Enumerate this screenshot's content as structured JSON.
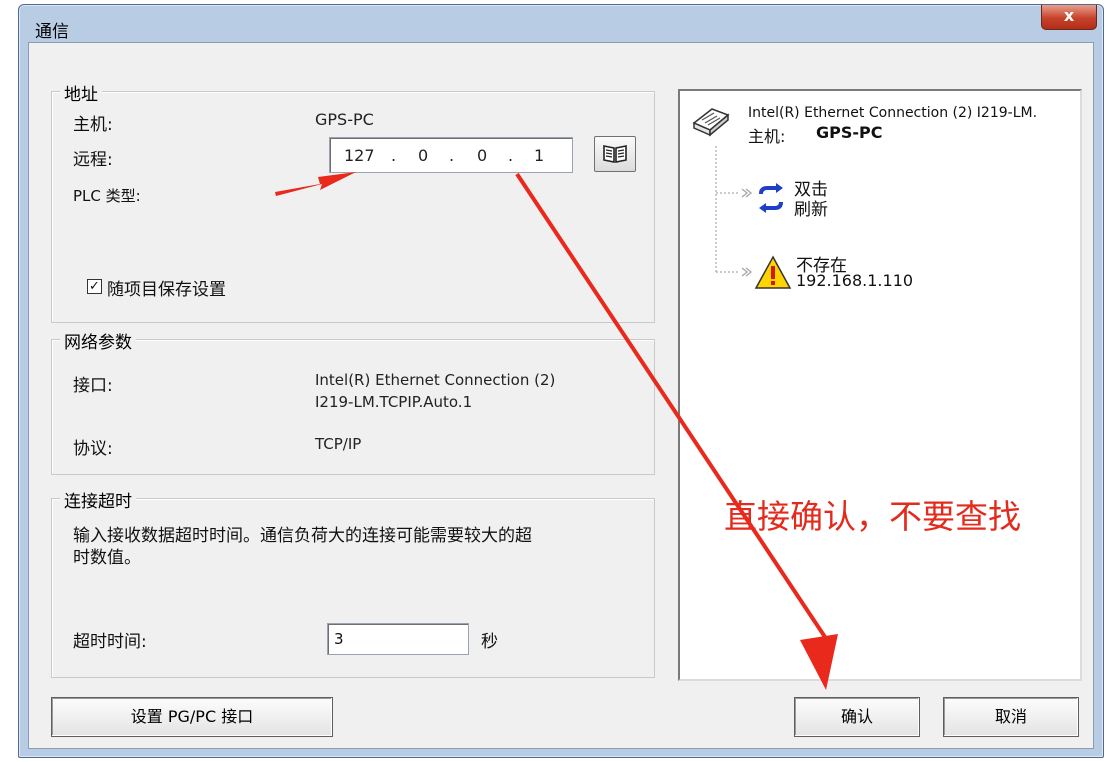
{
  "window": {
    "title": "通信",
    "close_label": "x"
  },
  "address": {
    "group_title": "地址",
    "host_label": "主机:",
    "host_value": "GPS-PC",
    "remote_label": "远程:",
    "ip_octets": [
      "127",
      "0",
      "0",
      "1"
    ],
    "ip_separator": ".",
    "plc_type_label": "PLC 类型:",
    "save_with_project_label": "随项目保存设置",
    "save_with_project_checked": true,
    "save_checkmark": "✓"
  },
  "network": {
    "group_title": "网络参数",
    "interface_label": "接口:",
    "interface_value_line1": "Intel(R) Ethernet Connection (2)",
    "interface_value_line2": "I219-LM.TCPIP.Auto.1",
    "protocol_label": "协议:",
    "protocol_value": "TCP/IP"
  },
  "timeout": {
    "group_title": "连接超时",
    "description_line1": "输入接收数据超时时间。通信负荷大的连接可能需要较大的超",
    "description_line2": "时数值。",
    "timeout_label": "超时时间:",
    "timeout_value": "3",
    "unit": "秒"
  },
  "tree": {
    "adapter_name": "Intel(R) Ethernet Connection (2) I219-LM.",
    "host_label": "主机:",
    "host_value": "GPS-PC",
    "refresh_line1": "双击",
    "refresh_line2": "刷新",
    "missing_line1": "不存在",
    "missing_line2": "192.168.1.110"
  },
  "buttons": {
    "set_pgpc": "设置 PG/PC 接口",
    "confirm": "确认",
    "cancel": "取消"
  },
  "annotation": {
    "text": "直接确认，不要查找",
    "color": "#e32a1c"
  },
  "icons": [
    "close-icon",
    "book-icon",
    "network-adapter-icon",
    "refresh-icon",
    "warning-icon",
    "checkbox-check-icon"
  ]
}
